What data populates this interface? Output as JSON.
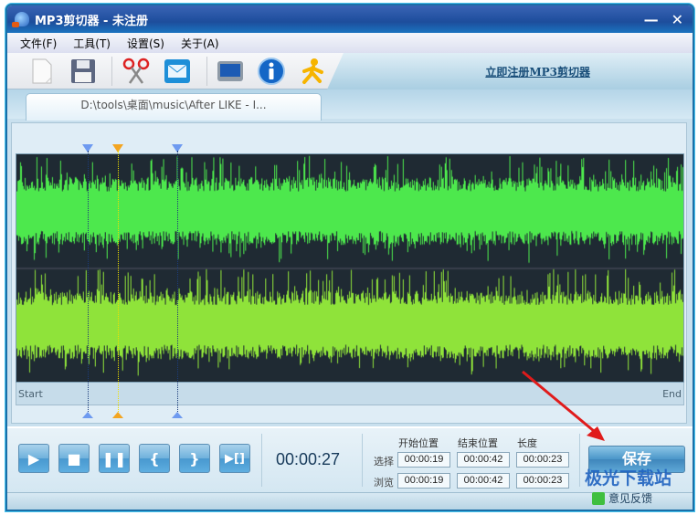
{
  "window": {
    "title": "MP3剪切器 - 未注册",
    "minimize": "—",
    "close": "✕"
  },
  "menu": [
    "文件(F)",
    "工具(T)",
    "设置(S)",
    "关于(A)"
  ],
  "toolbar": {
    "icons": [
      "new-file-icon",
      "save-icon",
      "cut-icon",
      "mail-icon",
      "screen-icon",
      "info-icon",
      "running-man-icon"
    ],
    "register_link": "立即注册MP3剪切器"
  },
  "tab": {
    "label": "D:\\tools\\桌面\\music\\After LIKE - I..."
  },
  "waveform": {
    "start_label": "Start",
    "end_label": "End",
    "colors": {
      "channel1": "#4de84d",
      "channel2": "#8fe33a",
      "background": "#1f2a33"
    }
  },
  "controls": {
    "buttons": [
      "play",
      "stop",
      "pause",
      "set-start",
      "set-end",
      "play-selection"
    ],
    "current_time": "00:00:27"
  },
  "positions": {
    "headers": [
      "开始位置",
      "结束位置",
      "长度"
    ],
    "rows": [
      {
        "label": "选择",
        "start": "00:00:19",
        "end": "00:00:42",
        "length": "00:00:23"
      },
      {
        "label": "浏览",
        "start": "00:00:19",
        "end": "00:00:42",
        "length": "00:00:23"
      }
    ]
  },
  "save_label": "保存",
  "feedback_label": "意见反馈",
  "watermark": "极光下载站"
}
